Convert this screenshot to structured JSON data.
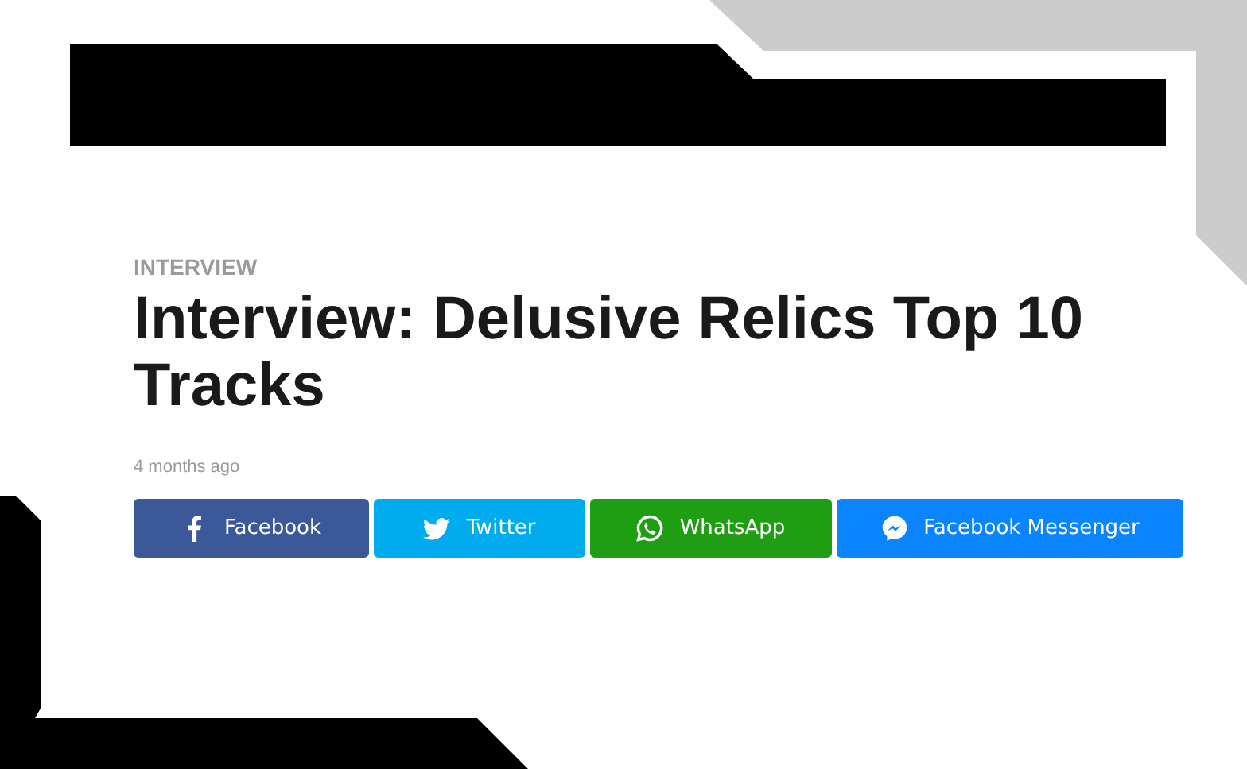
{
  "article": {
    "category": "INTERVIEW",
    "title": "Interview: Delusive Relics Top 10 Tracks",
    "date": "4 months ago"
  },
  "share_buttons": [
    {
      "kind": "facebook",
      "label": "Facebook"
    },
    {
      "kind": "twitter",
      "label": "Twitter"
    },
    {
      "kind": "whatsapp",
      "label": "WhatsApp"
    },
    {
      "kind": "messenger",
      "label": "Facebook Messenger"
    }
  ]
}
